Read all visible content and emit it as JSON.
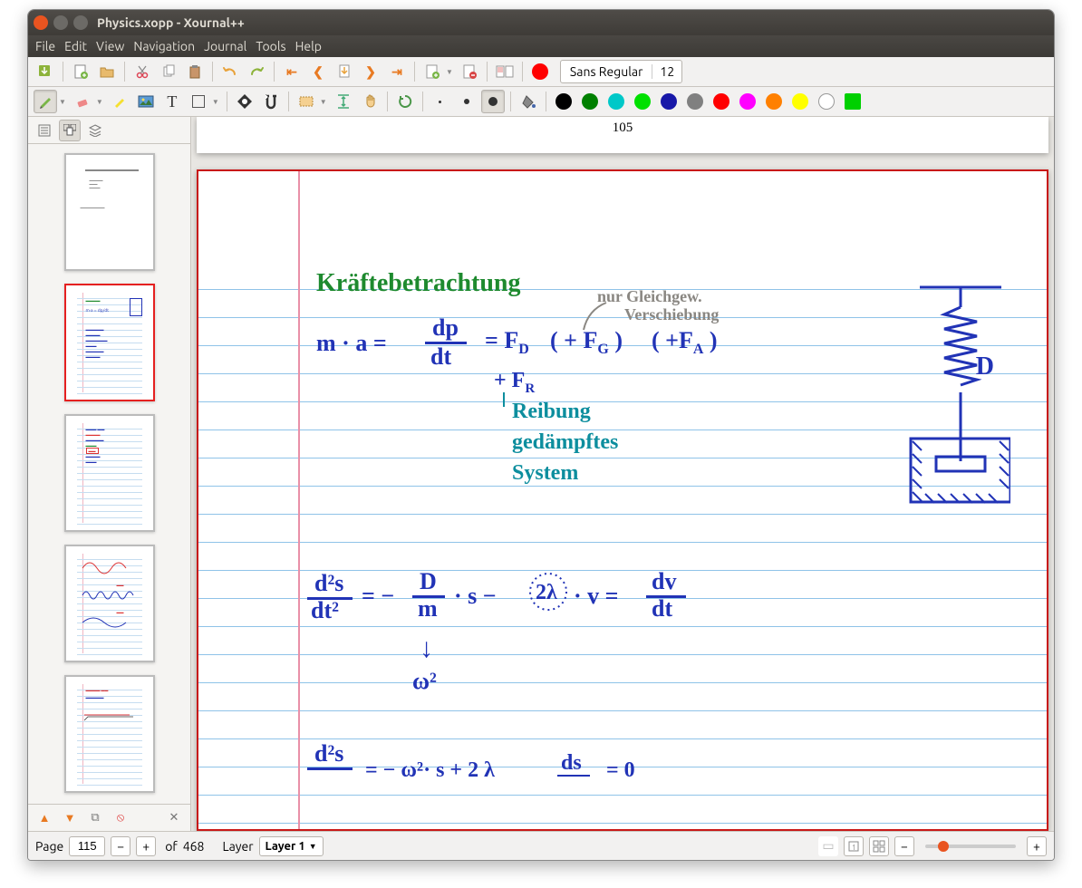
{
  "window": {
    "title": "Physics.xopp - Xournal++"
  },
  "menu": {
    "file": "File",
    "edit": "Edit",
    "view": "View",
    "navigation": "Navigation",
    "journal": "Journal",
    "tools": "Tools",
    "help": "Help"
  },
  "toolbar": {
    "font_name": "Sans Regular",
    "font_size": "12",
    "color_swatches": [
      "#000000",
      "#008000",
      "#00c8c8",
      "#00ff00",
      "#0000a0",
      "#404040",
      "#ff0000",
      "#ff00ff",
      "#ff8000",
      "#ffff00",
      "#ffffff",
      "#00ff00"
    ],
    "current_color": "#ff0000"
  },
  "sidebar": {
    "nav": {
      "up": "▲",
      "down": "▼",
      "copy": "⧉",
      "del": "⦸",
      "close": "✕"
    }
  },
  "canvas": {
    "prev_page_number": "105",
    "notes": {
      "title": "Kräftebetrachtung",
      "equation_main_left": "m · a  =",
      "equation_dp": "dp",
      "equation_dt": "dt",
      "equation_main_right": "=  F",
      "sub_D": "D",
      "plus_fg": "( + F",
      "sub_G": "G",
      "close_paren": ")",
      "plus_fa": "( +F",
      "sub_A": "A",
      "close_paren2": ")",
      "plus_fr": "+ F",
      "sub_R": "R",
      "annot_grey1": "nur Gleichgew.",
      "annot_grey2": "Verschiebung",
      "annot_teal1": "Reibung",
      "annot_teal2": "gedämpftes",
      "annot_teal3": "System",
      "spring_label": "D",
      "eq2_l": "d²s",
      "eq2_l2": "dt²",
      "eq2_mid": "=   −",
      "eq2_Dm_top": "D",
      "eq2_Dm_bot": "m",
      "eq2_dot_s": "· s   −",
      "eq2_2l": "2λ",
      "eq2_v": "· v   =",
      "eq2_dv": "dv",
      "eq2_dt": "dt",
      "eq2_arrow": "↓",
      "eq2_omega": "ω²",
      "eq3_l": "d²s",
      "eq3_partial": "=   − ω²· s   + 2 λ",
      "eq3_ds": "ds",
      "eq3_zero": "= 0"
    }
  },
  "status": {
    "page_label": "Page",
    "page_current": "115",
    "of_label": "of",
    "page_total": "468",
    "layer_label": "Layer",
    "layer_current": "Layer 1"
  }
}
